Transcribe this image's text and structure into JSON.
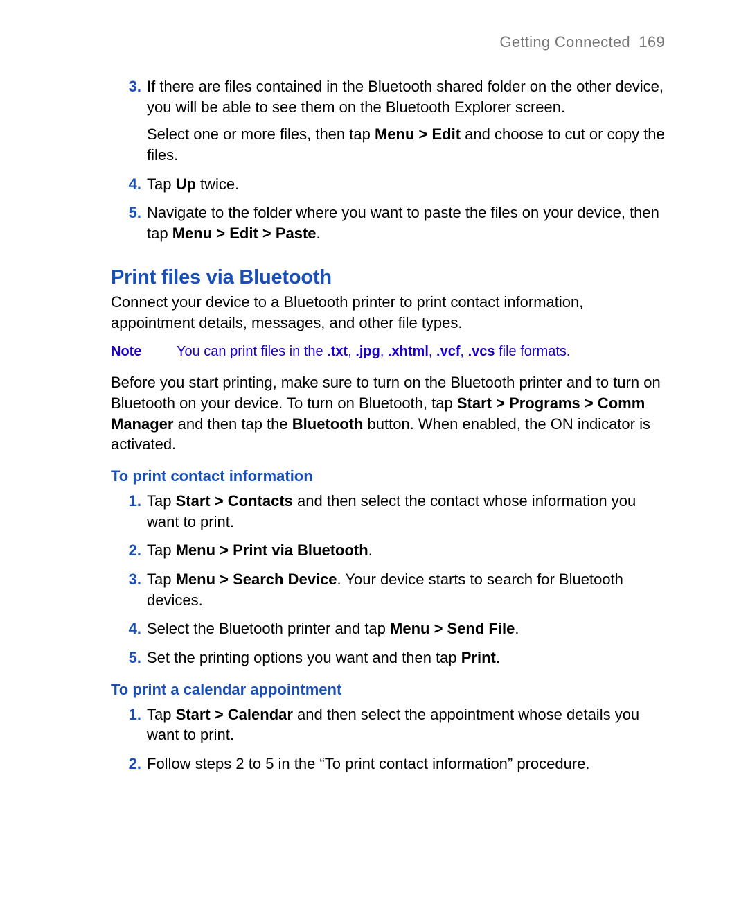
{
  "header": {
    "chapter": "Getting Connected",
    "page": "169"
  },
  "introSteps": [
    {
      "num": "3.",
      "paras": [
        [
          {
            "t": "If there are files contained in the Bluetooth shared folder on the other device, you will be able to see them on the Bluetooth Explorer screen."
          }
        ],
        [
          {
            "t": "Select one or more files, then tap "
          },
          {
            "t": "Menu > Edit",
            "b": true
          },
          {
            "t": " and choose to cut or copy the files."
          }
        ]
      ]
    },
    {
      "num": "4.",
      "paras": [
        [
          {
            "t": "Tap "
          },
          {
            "t": "Up",
            "b": true
          },
          {
            "t": " twice."
          }
        ]
      ]
    },
    {
      "num": "5.",
      "paras": [
        [
          {
            "t": "Navigate to the folder where you want to paste the files on your device, then tap "
          },
          {
            "t": "Menu > Edit > Paste",
            "b": true
          },
          {
            "t": "."
          }
        ]
      ]
    }
  ],
  "section": {
    "title": "Print files via Bluetooth",
    "intro": "Connect your device to a Bluetooth printer to print contact information, appointment details, messages, and other file types."
  },
  "note": {
    "label": "Note",
    "runs": [
      {
        "t": "You can print files in the "
      },
      {
        "t": ".txt",
        "b": true
      },
      {
        "t": ", "
      },
      {
        "t": ".jpg",
        "b": true
      },
      {
        "t": ", "
      },
      {
        "t": ".xhtml",
        "b": true
      },
      {
        "t": ", "
      },
      {
        "t": ".vcf",
        "b": true
      },
      {
        "t": ", "
      },
      {
        "t": ".vcs",
        "b": true
      },
      {
        "t": " file formats."
      }
    ]
  },
  "beforePrint": [
    {
      "t": "Before you start printing, make sure to turn on the Bluetooth printer and to turn on Bluetooth on your device. To turn on Bluetooth, tap "
    },
    {
      "t": "Start > Programs > Comm Manager",
      "b": true
    },
    {
      "t": " and then tap the "
    },
    {
      "t": "Bluetooth",
      "b": true
    },
    {
      "t": " button. When enabled, the ON indicator is activated."
    }
  ],
  "contact": {
    "title": "To print contact information",
    "steps": [
      {
        "num": "1.",
        "paras": [
          [
            {
              "t": "Tap "
            },
            {
              "t": "Start > Contacts",
              "b": true
            },
            {
              "t": " and then select the contact whose information you want to print."
            }
          ]
        ]
      },
      {
        "num": "2.",
        "paras": [
          [
            {
              "t": "Tap "
            },
            {
              "t": "Menu > Print via Bluetooth",
              "b": true
            },
            {
              "t": "."
            }
          ]
        ]
      },
      {
        "num": "3.",
        "paras": [
          [
            {
              "t": "Tap "
            },
            {
              "t": "Menu > Search Device",
              "b": true
            },
            {
              "t": ". Your device starts to search for Bluetooth devices."
            }
          ]
        ]
      },
      {
        "num": "4.",
        "paras": [
          [
            {
              "t": "Select the Bluetooth printer and tap "
            },
            {
              "t": "Menu > Send File",
              "b": true
            },
            {
              "t": "."
            }
          ]
        ]
      },
      {
        "num": "5.",
        "paras": [
          [
            {
              "t": "Set the printing options you want and then tap "
            },
            {
              "t": "Print",
              "b": true
            },
            {
              "t": "."
            }
          ]
        ]
      }
    ]
  },
  "calendar": {
    "title": "To print a calendar appointment",
    "steps": [
      {
        "num": "1.",
        "paras": [
          [
            {
              "t": "Tap "
            },
            {
              "t": "Start > Calendar",
              "b": true
            },
            {
              "t": " and then select the appointment whose details you want to print."
            }
          ]
        ]
      },
      {
        "num": "2.",
        "paras": [
          [
            {
              "t": "Follow steps 2 to 5 in the “To print contact information” procedure."
            }
          ]
        ]
      }
    ]
  }
}
